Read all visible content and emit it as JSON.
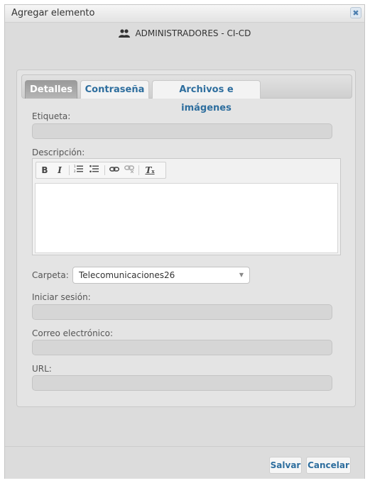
{
  "dialog": {
    "title": "Agregar elemento",
    "close_symbol": "✖"
  },
  "group": {
    "icon": "users-icon",
    "name": "ADMINISTRADORES - CI-CD"
  },
  "tabs": [
    {
      "label": "Detalles",
      "active": true
    },
    {
      "label": "Contraseña",
      "active": false
    },
    {
      "label": "Archivos e imágenes",
      "active": false
    }
  ],
  "form": {
    "label_field": {
      "label": "Etiqueta:",
      "value": ""
    },
    "description": {
      "label": "Descripción:",
      "value": ""
    },
    "folder": {
      "label": "Carpeta:",
      "selected": "Telecomunicaciones26"
    },
    "login": {
      "label": "Iniciar sesión:",
      "value": ""
    },
    "email": {
      "label": "Correo electrónico:",
      "value": ""
    },
    "url": {
      "label": "URL:",
      "value": ""
    }
  },
  "editor_toolbar": {
    "bold": "B",
    "italic": "I",
    "numbered_list_icon": "numbered-list-icon",
    "bulleted_list_icon": "bulleted-list-icon",
    "link_icon": "link-icon",
    "unlink_icon": "unlink-icon",
    "remove_format": "T"
  },
  "buttons": {
    "save": "Salvar",
    "cancel": "Cancelar"
  },
  "colors": {
    "accent": "#2e6e9e",
    "active_tab": "#a7a7a7",
    "field_bg": "#d6d6d6"
  }
}
